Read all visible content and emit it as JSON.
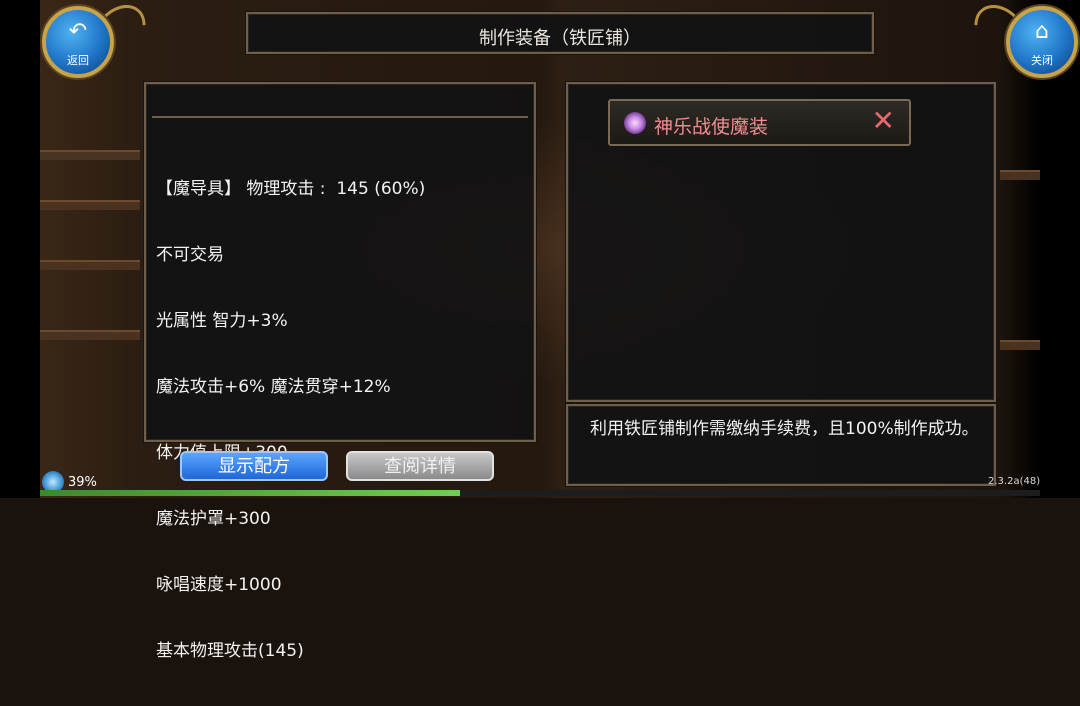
{
  "title": "制作装备（铁匠铺）",
  "back_button": {
    "glyph": "↶",
    "label": "返回"
  },
  "close_button": {
    "glyph": "⌂",
    "label": "关闭"
  },
  "item_stats": [
    "【魔导具】 物理攻击 :  145 (60%)",
    "不可交易",
    "光属性 智力+3%",
    "魔法攻击+6% 魔法贯穿+12%",
    "体力值上限+300",
    "魔法护罩+300",
    "咏唱速度+1000",
    "基本物理攻击(145)"
  ],
  "recipe_tab": {
    "label": "神乐战使魔装",
    "close_glyph": "✕"
  },
  "description": "利用铁匠铺制作需缴纳手续费，且100%制作成功。",
  "buttons": {
    "show_recipe": "显示配方",
    "view_detail": "查阅详情"
  },
  "status": {
    "battery": "39%",
    "progress": 0.42,
    "version": "2.3.2a(48)"
  },
  "colors": {
    "accent": "#1f74c6",
    "tab_text": "#f08e8e",
    "frame": "#6e5e4a"
  }
}
